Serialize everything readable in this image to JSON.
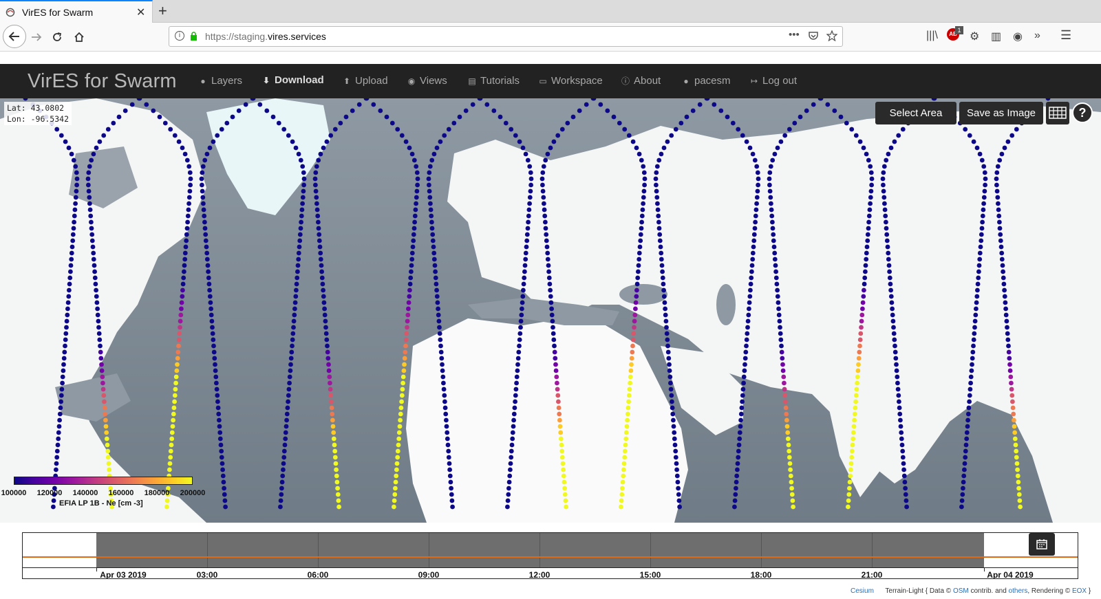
{
  "browser": {
    "tab_title": "VirES for Swarm",
    "tab_close": "✕",
    "new_tab": "+",
    "url_prefix": "https://staging.",
    "url_domain": "vires.services",
    "url_suffix": "",
    "page_actions": "•••",
    "addon_badge": "1"
  },
  "app": {
    "brand": "VirES for Swarm",
    "menu": {
      "layers": "Layers",
      "download": "Download",
      "upload": "Upload",
      "views": "Views",
      "tutorials": "Tutorials",
      "workspace": "Workspace",
      "about": "About",
      "user": "pacesm",
      "logout": "Log out"
    }
  },
  "map": {
    "lat": "Lat: 43.0802",
    "lon": "Lon: -96.5342",
    "select_area": "Select Area",
    "save_image": "Save as Image",
    "help": "?",
    "legend": {
      "ticks": [
        "100000",
        "120000",
        "140000",
        "160000",
        "180000",
        "200000"
      ],
      "title": "EFIA LP 1B - Ne [cm -3]",
      "range": [
        100000,
        200000
      ],
      "colormap": "plasma"
    }
  },
  "timeline": {
    "labels": [
      "Apr 03 2019",
      "03:00",
      "06:00",
      "09:00",
      "12:00",
      "15:00",
      "18:00",
      "21:00",
      "Apr 04 2019"
    ],
    "selection_color": "#6e6e6e",
    "line_color": "#e06a14"
  },
  "attribution": {
    "cesium": "Cesium",
    "text1": "Terrain-Light { Data ©",
    "osm": "OSM",
    "text2": "contrib. and",
    "others": "others",
    "text3": ", Rendering ©",
    "eox": "EOX",
    "text4": "}"
  },
  "colors": {
    "header_bg": "#222222",
    "track_low": "#0d0887",
    "track_high": "#f0f921"
  }
}
